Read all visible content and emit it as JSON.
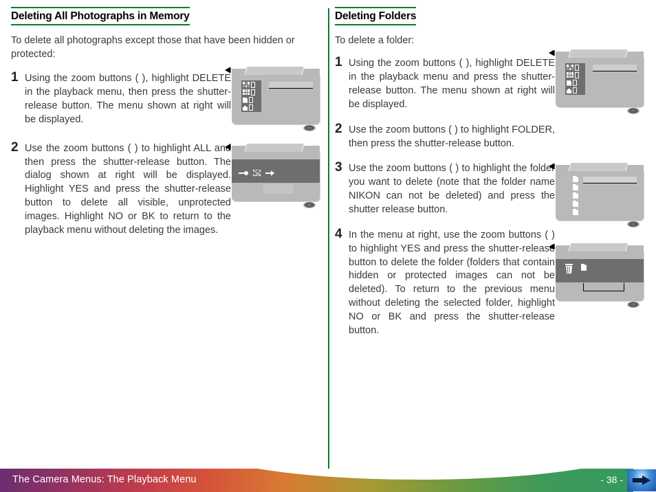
{
  "footer": {
    "title": "The Camera Menus: The Playback Menu",
    "page": "- 38 -",
    "next_icon": "arrow-right-icon",
    "accent_green": "#0a7b33"
  },
  "left_column": {
    "heading": "Deleting All Photographs in Memory",
    "intro": "To delete all photographs except those that have been hidden or protected:",
    "steps": [
      {
        "num": "1",
        "text": "Using the zoom buttons (      ), highlight DELETE in the playback menu, then press the shutter-release button.   The menu shown at right will be displayed.",
        "screen": "playback-menu-delete"
      },
      {
        "num": "2",
        "text": "Use the zoom buttons (      ) to highlight ALL and then press the shutter-release button.  The dialog shown at right will be displayed.   Highlight YES and press the shutter-release button to delete all visible, unprotected images.  Highlight NO or BK to return to the playback menu without deleting the images.",
        "screen": "delete-all-confirm-dialog"
      }
    ]
  },
  "right_column": {
    "heading": "Deleting Folders",
    "intro": "To delete a folder:",
    "steps": [
      {
        "num": "1",
        "text": "Using the zoom buttons (      ), highlight DELETE in the playback menu and press the shutter-release button.   The menu shown at right will be displayed.",
        "screen": "playback-menu-delete"
      },
      {
        "num": "2",
        "text": "Use the zoom buttons (      ) to highlight FOLDER, then press the shutter-release button.",
        "screen": null
      },
      {
        "num": "3",
        "text": "Use the zoom buttons (      ) to highlight the folder you want to delete (note that the folder name NIKON can not be deleted) and press the shutter release button.",
        "screen": "folder-list"
      },
      {
        "num": "4",
        "text": "In the menu at right, use the zoom buttons (      ) to highlight YES and press the shutter-release button to delete the folder (folders that contain hidden or protected images can not be deleted).  To return to the previous menu without deleting the selected folder, highlight NO or BK  and press the shutter-release button.",
        "screen": "delete-folder-confirm-dialog"
      }
    ]
  }
}
